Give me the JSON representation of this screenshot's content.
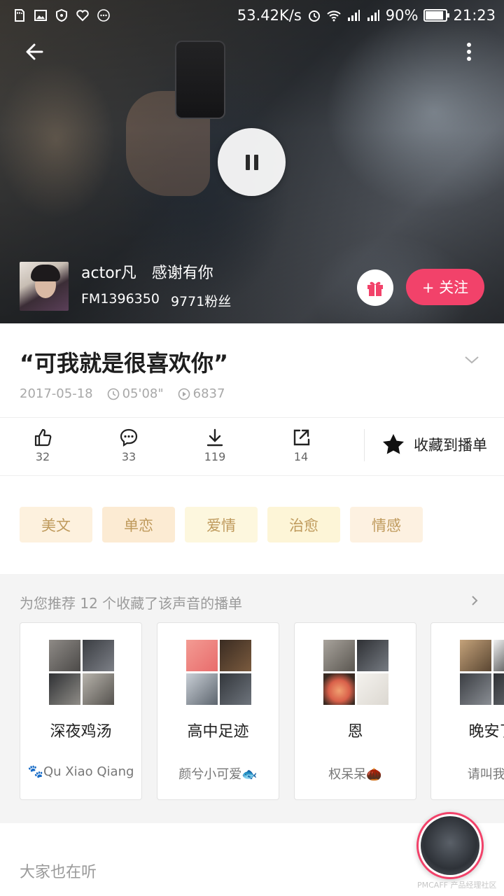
{
  "status_bar": {
    "speed": "53.42K/s",
    "battery": "90%",
    "battery_level": 0.9,
    "time": "21:23",
    "icons": [
      "sd-card-icon",
      "image-icon",
      "shield-icon",
      "heart-shield-icon",
      "more-dots-icon",
      "alarm-icon",
      "wifi-icon",
      "signal-icon",
      "signal-icon"
    ]
  },
  "hero": {
    "play_state": "pause-icon",
    "host_name": "actor凡　感谢有你",
    "host_fm": "FM1396350",
    "host_fans": "9771粉丝",
    "follow_label": "+ 关注",
    "follow_color": "#f2426a"
  },
  "track": {
    "title": "“可我就是很喜欢你”",
    "date": "2017-05-18",
    "duration": "05'08\"",
    "plays": "6837"
  },
  "actions": {
    "like_count": "32",
    "comment_count": "33",
    "download_count": "119",
    "share_count": "14",
    "collect_label": "收藏到播单"
  },
  "tags": [
    {
      "label": "美文",
      "bg": "#fdf1de"
    },
    {
      "label": "单恋",
      "bg": "#fcebd3"
    },
    {
      "label": "爱情",
      "bg": "#fdf7de"
    },
    {
      "label": "治愈",
      "bg": "#fdf5d7"
    },
    {
      "label": "情感",
      "bg": "#fdf1e1"
    }
  ],
  "recommend": {
    "header": "为您推荐 12 个收藏了该声音的播单",
    "cards": [
      {
        "title": "深夜鸡汤",
        "author": "🐾Qu Xiao Qiang"
      },
      {
        "title": "高中足迹",
        "author": "颜兮小可爱🐟"
      },
      {
        "title": "恩",
        "author": "权呆呆🌰"
      },
      {
        "title": "晚安了",
        "author": "请叫我M"
      }
    ]
  },
  "also_listening": {
    "title": "大家也在听"
  },
  "watermark": "PMCAFF 产品经理社区"
}
